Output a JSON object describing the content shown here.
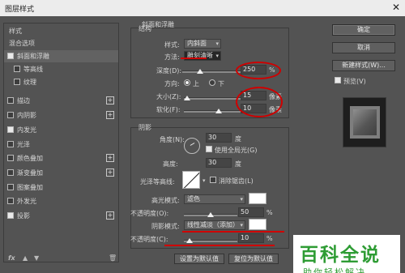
{
  "window": {
    "title": "图层样式",
    "close_icon": "close-icon"
  },
  "sidebar": {
    "items": [
      {
        "label": "样式",
        "header": true
      },
      {
        "label": "混合选项",
        "header": true
      },
      {
        "label": "斜面和浮雕",
        "checked": true,
        "selected": true
      },
      {
        "label": "等高线",
        "checked": false,
        "sub": true
      },
      {
        "label": "纹理",
        "checked": false,
        "sub": true
      },
      {
        "label": "描边",
        "checked": false,
        "plus": true
      },
      {
        "label": "内阴影",
        "checked": false,
        "plus": true
      },
      {
        "label": "内发光",
        "checked": true
      },
      {
        "label": "光泽",
        "checked": false
      },
      {
        "label": "颜色叠加",
        "checked": false,
        "plus": true
      },
      {
        "label": "渐变叠加",
        "checked": false,
        "plus": true
      },
      {
        "label": "图案叠加",
        "checked": false
      },
      {
        "label": "外发光",
        "checked": false
      },
      {
        "label": "投影",
        "checked": true,
        "plus": true
      }
    ],
    "footer": {
      "fx": "fx",
      "up": "▲",
      "down": "▼",
      "trash": "🗑"
    }
  },
  "bevel": {
    "section_title": "斜面和浮雕",
    "structure_title": "结构",
    "style_label": "样式:",
    "style_value": "内斜面",
    "method_label": "方法:",
    "method_value": "雕刻清晰",
    "depth_label": "深度(D):",
    "depth_value": "250",
    "depth_unit": "%",
    "depth_level": 0.3,
    "direction_label": "方向:",
    "dir_up": "上",
    "dir_down": "下",
    "size_label": "大小(Z):",
    "size_value": "15",
    "size_unit": "像素",
    "size_level": 0.06,
    "soften_label": "软化(F):",
    "soften_value": "10",
    "soften_unit": "像素",
    "soften_level": 0.62
  },
  "shading": {
    "title": "阴影",
    "angle_label": "角度(N):",
    "angle_value": "30",
    "angle_unit": "度",
    "global_light": "使用全局光(G)",
    "altitude_label": "高度:",
    "altitude_value": "30",
    "altitude_unit": "度",
    "gloss_label": "光泽等高线:",
    "antialias": "消除锯齿(L)",
    "highlight_label": "高光模式:",
    "highlight_value": "滤色",
    "hl_opacity_label": "不透明度(O):",
    "hl_opacity_value": "50",
    "hl_opacity_level": 0.5,
    "shadow_label": "阴影模式:",
    "shadow_value": "线性减淡（添加）",
    "sh_opacity_label": "不透明度(C):",
    "sh_opacity_value": "10",
    "sh_opacity_level": 0.1,
    "pct": "%",
    "make_default": "设置为默认值",
    "reset_default": "复位为默认值"
  },
  "right": {
    "ok": "确定",
    "cancel": "取消",
    "new_style": "新建样式(W)...",
    "preview_label": "预览(V)",
    "preview_checked": true
  },
  "watermark": {
    "line1": "百科全说",
    "line2": "助你轻松解决"
  },
  "colors": {
    "annotation": "#cf0000",
    "watermark": "#2e9c34"
  }
}
